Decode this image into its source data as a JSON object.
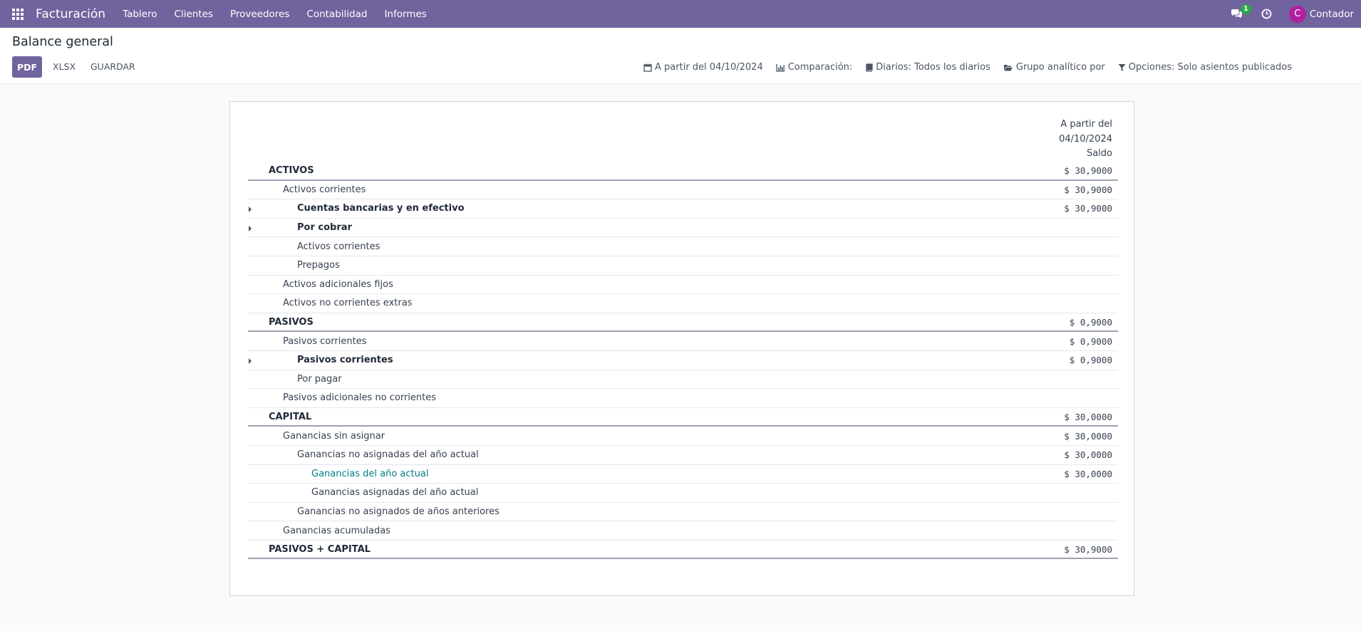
{
  "navbar": {
    "app_name": "Facturación",
    "menu": [
      "Tablero",
      "Clientes",
      "Proveedores",
      "Contabilidad",
      "Informes"
    ],
    "messages_count": "1",
    "user_initial": "C",
    "user_name": "Contador",
    "accent_color": "#71639e"
  },
  "control_panel": {
    "title": "Balance general",
    "pdf_label": "PDF",
    "xlsx_label": "XLSX",
    "save_label": "GUARDAR",
    "filters": {
      "date": "A partir del 04/10/2024",
      "comparison": "Comparación:",
      "journals": "Diarios: Todos los diarios",
      "analytic": "Grupo analítico por",
      "options": "Opciones: Solo asientos publicados"
    }
  },
  "report": {
    "column_header": {
      "line1": "A partir del",
      "line2": "04/10/2024",
      "line3": "Saldo"
    },
    "rows": [
      {
        "name": "ACTIVOS",
        "amount": "$ 30,9000"
      },
      {
        "name": "Activos corrientes",
        "amount": "$ 30,9000"
      },
      {
        "name": "Cuentas bancarias y en efectivo",
        "amount": "$ 30,9000"
      },
      {
        "name": "Por cobrar",
        "amount": ""
      },
      {
        "name": "Activos corrientes",
        "amount": ""
      },
      {
        "name": "Prepagos",
        "amount": ""
      },
      {
        "name": "Activos adicionales fijos",
        "amount": ""
      },
      {
        "name": "Activos no corrientes extras",
        "amount": ""
      },
      {
        "name": "PASIVOS",
        "amount": "$ 0,9000"
      },
      {
        "name": "Pasivos corrientes",
        "amount": "$ 0,9000"
      },
      {
        "name": "Pasivos corrientes",
        "amount": "$ 0,9000"
      },
      {
        "name": "Por pagar",
        "amount": ""
      },
      {
        "name": "Pasivos adicionales no corrientes",
        "amount": ""
      },
      {
        "name": "CAPITAL",
        "amount": "$ 30,0000"
      },
      {
        "name": "Ganancias sin asignar",
        "amount": "$ 30,0000"
      },
      {
        "name": "Ganancias no asignadas del año actual",
        "amount": "$ 30,0000"
      },
      {
        "name": "Ganancias del año actual",
        "amount": "$ 30,0000"
      },
      {
        "name": "Ganancias asignadas del año actual",
        "amount": ""
      },
      {
        "name": "Ganancias no asignados de años anteriores",
        "amount": ""
      },
      {
        "name": "Ganancias acumuladas",
        "amount": ""
      },
      {
        "name": "PASIVOS + CAPITAL",
        "amount": "$ 30,9000"
      }
    ]
  }
}
